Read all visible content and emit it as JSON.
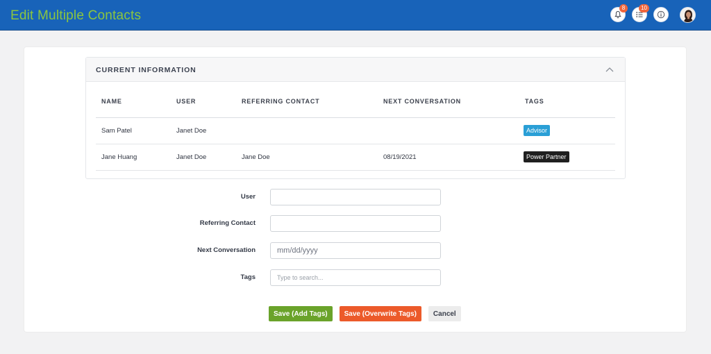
{
  "header": {
    "title": "Edit Multiple Contacts",
    "notifications_badge": "8",
    "tasks_badge": "10",
    "icons": [
      "bell-icon",
      "task-list-icon",
      "info-icon",
      "avatar"
    ]
  },
  "current_info": {
    "title": "CURRENT INFORMATION",
    "columns": [
      "NAME",
      "USER",
      "REFERRING CONTACT",
      "NEXT CONVERSATION",
      "TAGS"
    ],
    "rows": [
      {
        "name": "Sam Patel",
        "user": "Janet Doe",
        "referring": "",
        "next": "",
        "tag": "Advisor",
        "tag_color": "#2a9fd6"
      },
      {
        "name": "Jane Huang",
        "user": "Janet Doe",
        "referring": "Jane Doe",
        "next": "08/19/2021",
        "tag": "Power Partner",
        "tag_color": "#1f1f1f"
      }
    ]
  },
  "form": {
    "user_label": "User",
    "user_value": "",
    "referring_label": "Referring Contact",
    "referring_value": "",
    "next_label": "Next Conversation",
    "next_placeholder": "mm/dd/yyyy",
    "tags_label": "Tags",
    "tags_placeholder": "Type to search..."
  },
  "actions": {
    "save_add": "Save (Add Tags)",
    "save_overwrite": "Save (Overwrite Tags)",
    "cancel": "Cancel"
  },
  "colors": {
    "header_bg": "#1863b9",
    "title_green": "#8cc63f",
    "badge": "#f1663c",
    "btn_green": "#6aa32a",
    "btn_orange": "#ec5a2a"
  }
}
